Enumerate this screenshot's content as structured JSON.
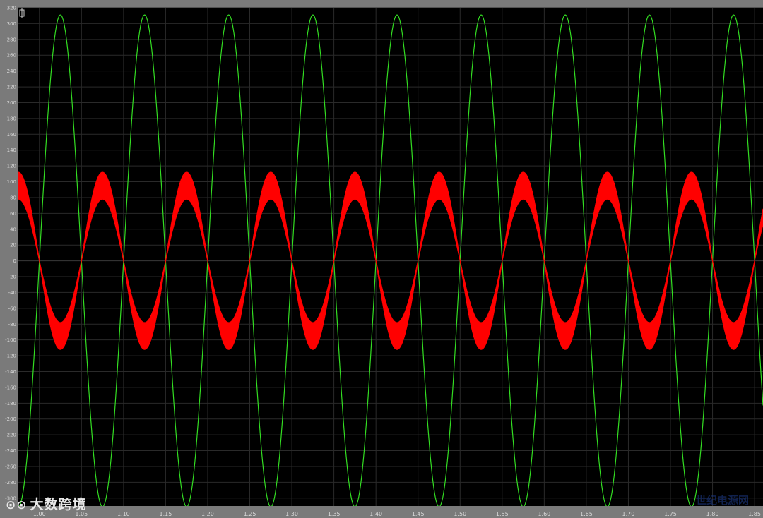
{
  "chart_data": {
    "type": "line",
    "title": "",
    "xlabel": "",
    "ylabel": "",
    "xlim": [
      0.975,
      1.86
    ],
    "ylim": [
      -310,
      320
    ],
    "grid": true,
    "background": "#000000",
    "yticks": [
      320,
      300,
      280,
      260,
      240,
      220,
      200,
      180,
      160,
      140,
      120,
      100,
      80,
      60,
      40,
      20,
      0,
      -20,
      -40,
      -60,
      -80,
      -100,
      -120,
      -140,
      -160,
      -180,
      -200,
      -220,
      -240,
      -260,
      -280,
      -300
    ],
    "xticks": [
      1.0,
      1.05,
      1.1,
      1.15,
      1.2,
      1.25,
      1.3,
      1.35,
      1.4,
      1.45,
      1.5,
      1.55,
      1.6,
      1.65,
      1.7,
      1.75,
      1.8,
      1.85
    ],
    "xtick_labels": [
      "1.00",
      "1.05",
      "1.10",
      "1.15",
      "1.20",
      "1.25",
      "1.30",
      "1.35",
      "1.40",
      "1.45",
      "1.50",
      "1.55",
      "1.60",
      "1.65",
      "1.70",
      "1.75",
      "1.80",
      "1.85"
    ],
    "series": [
      {
        "color": "#33dd22",
        "style": "sine",
        "amplitude": 311,
        "frequency_hz": 10,
        "zero_crossing_rising": 1.0
      },
      {
        "color": "#ff0000",
        "style": "sine-band",
        "amplitude_outer": 112,
        "amplitude_inner": 78,
        "frequency_hz": 10,
        "zero_crossing_falling": 1.0
      }
    ]
  },
  "watermark": {
    "icon": "ibo-logo-icon",
    "text": "大数跨境",
    "corner_text": "世纪电源网"
  }
}
